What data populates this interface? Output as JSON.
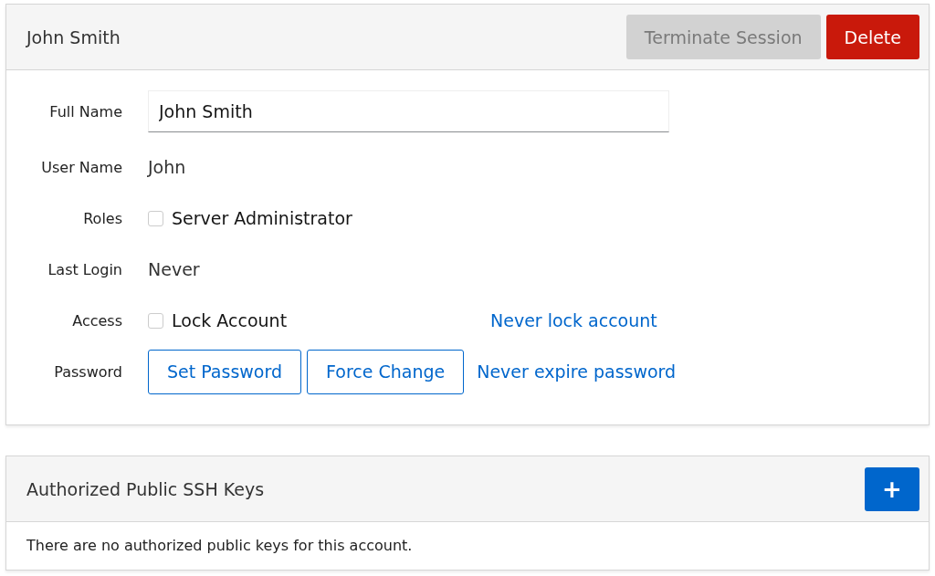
{
  "account_panel": {
    "title": "John Smith",
    "actions": [
      {
        "label": "Terminate Session",
        "kind": "secondary",
        "disabled": true
      },
      {
        "label": "Delete",
        "kind": "danger",
        "disabled": false
      }
    ],
    "fields": [
      {
        "kind": "input",
        "label": "Full Name",
        "value": "John Smith"
      },
      {
        "kind": "text",
        "label": "User Name",
        "value": "John"
      },
      {
        "kind": "checkbox",
        "label": "Roles",
        "option": "Server Administrator",
        "checked": false
      },
      {
        "kind": "text",
        "label": "Last Login",
        "value": "Never"
      },
      {
        "kind": "checkbox",
        "label": "Access",
        "option": "Lock Account",
        "checked": false,
        "link": "Never lock account"
      },
      {
        "kind": "buttons",
        "label": "Password",
        "buttons": [
          "Set Password",
          "Force Change"
        ],
        "link": "Never expire password"
      }
    ]
  },
  "ssh_keys_panel": {
    "title": "Authorized Public SSH Keys",
    "add_button": "+",
    "empty_message": "There are no authorized public keys for this account."
  }
}
